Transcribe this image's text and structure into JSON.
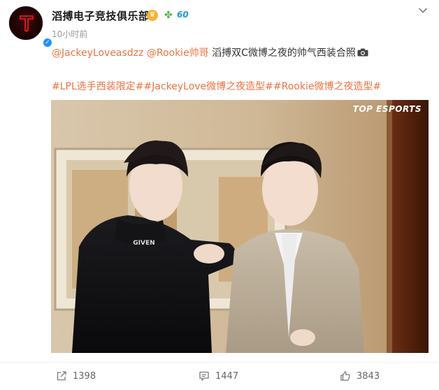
{
  "post": {
    "author": "滔搏电子竞技俱乐部",
    "level": "60",
    "time": "10小时前",
    "mention1": "@JackeyLoveasdzz",
    "mention2": "@Rookie帅哥",
    "text": " 滔搏双C微博之夜的帅气西装合照",
    "hashtags": "#LPL选手西装限定##JackeyLove微博之夜造型##Rookie微博之夜造型#"
  },
  "photo": {
    "watermark": "TOP ESPORTS"
  },
  "actions": {
    "repost": "1398",
    "comment": "1447",
    "like": "3843"
  },
  "icons": {
    "avatar_logo": "team-logo-icon",
    "verified": "verified-badge-icon",
    "crown": "crown-badge-icon",
    "clover": "clover-icon",
    "more": "chevron-down-icon",
    "camera": "camera-icon",
    "repost": "share-icon",
    "comment": "comment-icon",
    "like": "thumbs-up-icon"
  },
  "colors": {
    "mention": "#eb7340",
    "verified": "#1e90ff",
    "level": "#1c9bd6"
  }
}
